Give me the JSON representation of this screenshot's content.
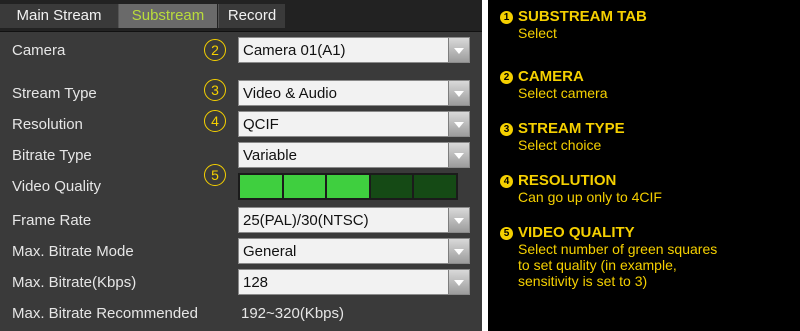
{
  "tabs": [
    {
      "label": "Main Stream",
      "active": false
    },
    {
      "label": "Substream",
      "active": true
    },
    {
      "label": "Record",
      "active": false
    }
  ],
  "callouts": [
    "1",
    "2",
    "3",
    "4",
    "5"
  ],
  "fields": {
    "camera": {
      "label": "Camera",
      "value": "Camera 01(A1)"
    },
    "stream_type": {
      "label": "Stream Type",
      "value": "Video & Audio"
    },
    "resolution": {
      "label": "Resolution",
      "value": "QCIF"
    },
    "bitrate_type": {
      "label": "Bitrate Type",
      "value": "Variable"
    },
    "video_quality": {
      "label": "Video Quality",
      "level": 3,
      "max": 5
    },
    "frame_rate": {
      "label": "Frame Rate",
      "value": "25(PAL)/30(NTSC)"
    },
    "max_bitrate_mode": {
      "label": "Max. Bitrate Mode",
      "value": "General"
    },
    "max_bitrate": {
      "label": "Max. Bitrate(Kbps)",
      "value": "128"
    },
    "max_bitrate_recommended": {
      "label": "Max. Bitrate Recommended",
      "value": "192~320(Kbps)"
    }
  },
  "legend": [
    {
      "num": "1",
      "title": "SUBSTREAM TAB",
      "desc": [
        "Select"
      ]
    },
    {
      "num": "2",
      "title": "CAMERA",
      "desc": [
        "Select camera"
      ]
    },
    {
      "num": "3",
      "title": "STREAM TYPE",
      "desc": [
        "Select choice"
      ]
    },
    {
      "num": "4",
      "title": "RESOLUTION",
      "desc": [
        "Can go up only to 4CIF"
      ]
    },
    {
      "num": "5",
      "title": "VIDEO QUALITY",
      "desc": [
        "Select number of green squares",
        "to set quality (in example,",
        "sensitivity is set to 3)"
      ]
    }
  ],
  "colors": {
    "active_tab": "#b9dc3c",
    "callout": "#f5d000",
    "quality_on": "#3fcf3f",
    "quality_off": "#154a15"
  }
}
